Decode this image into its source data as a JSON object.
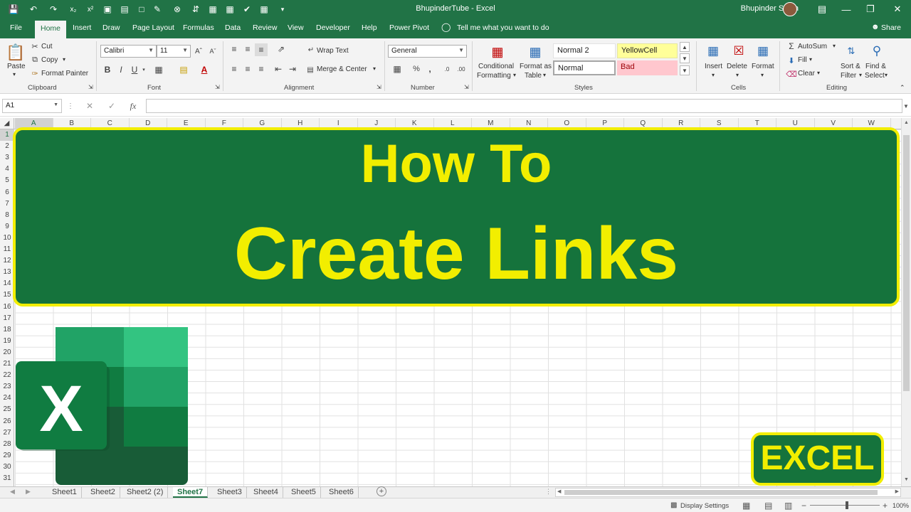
{
  "window": {
    "title": "BhupinderTube  -  Excel",
    "user": "Bhupinder Singh"
  },
  "tabs": [
    "File",
    "Home",
    "Insert",
    "Draw",
    "Page Layout",
    "Formulas",
    "Data",
    "Review",
    "View",
    "Developer",
    "Help",
    "Power Pivot"
  ],
  "tell_me": "Tell me what you want to do",
  "share": "Share",
  "clipboard": {
    "paste": "Paste",
    "cut": "Cut",
    "copy": "Copy",
    "format_painter": "Format Painter",
    "label": "Clipboard"
  },
  "font": {
    "name": "Calibri",
    "size": "11",
    "label": "Font",
    "bold": "B",
    "italic": "I",
    "underline": "U"
  },
  "alignment": {
    "wrap": "Wrap Text",
    "merge": "Merge & Center",
    "label": "Alignment"
  },
  "number": {
    "format": "General",
    "label": "Number"
  },
  "styles": {
    "conditional": "Conditional",
    "conditional2": "Formatting",
    "format_as": "Format as",
    "format_as2": "Table",
    "normal2": "Normal 2",
    "yellowcell": "YellowCell",
    "normal": "Normal",
    "bad": "Bad",
    "label": "Styles"
  },
  "cells": {
    "insert": "Insert",
    "delete": "Delete",
    "format": "Format",
    "label": "Cells"
  },
  "editing": {
    "autosum": "AutoSum",
    "fill": "Fill",
    "clear": "Clear",
    "sort": "Sort &",
    "sort2": "Filter",
    "find": "Find &",
    "find2": "Select",
    "label": "Editing"
  },
  "namebox": "A1",
  "columns": [
    "A",
    "B",
    "C",
    "D",
    "E",
    "F",
    "G",
    "H",
    "I",
    "J",
    "K",
    "L",
    "M",
    "N",
    "O",
    "P",
    "Q",
    "R",
    "S",
    "T",
    "U",
    "V",
    "W"
  ],
  "rows": [
    "1",
    "2",
    "3",
    "4",
    "5",
    "6",
    "7",
    "8",
    "9",
    "10",
    "11",
    "12",
    "13",
    "14",
    "15",
    "16",
    "17",
    "18",
    "19",
    "20",
    "21",
    "22",
    "23",
    "24",
    "25",
    "26",
    "27",
    "28",
    "29",
    "30",
    "31"
  ],
  "banner": {
    "line1": "How To",
    "line2": "Create Links"
  },
  "badge": "EXCEL",
  "logo_letter": "X",
  "sheets": [
    "Sheet1",
    "Sheet2",
    "Sheet2 (2)",
    "Sheet7",
    "Sheet3",
    "Sheet4",
    "Sheet5",
    "Sheet6"
  ],
  "active_sheet": "Sheet7",
  "status": {
    "display_settings": "Display Settings",
    "zoom": "100%"
  },
  "colors": {
    "excel_green": "#217346",
    "banner_green": "#15733c",
    "banner_yellow": "#f2ee00"
  }
}
